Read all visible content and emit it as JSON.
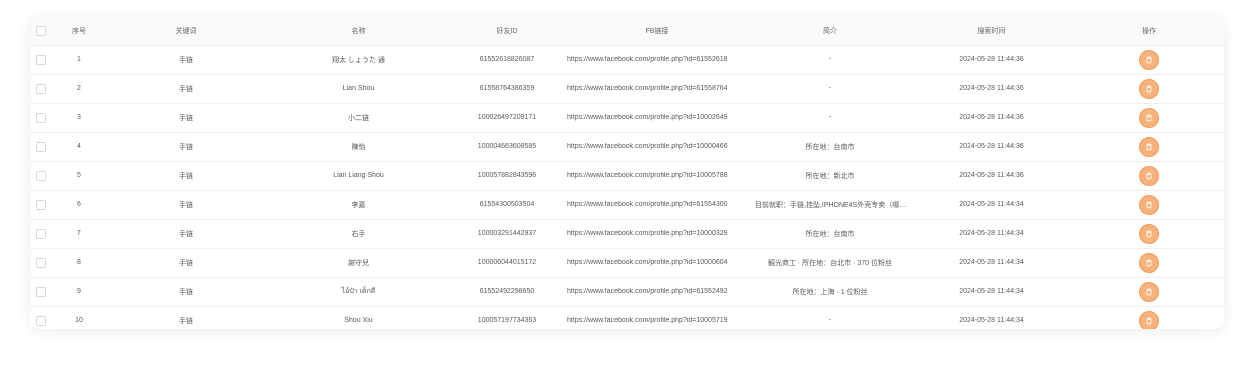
{
  "columns": {
    "index": "序号",
    "keyword": "关键词",
    "name": "名称",
    "friend_id": "好友ID",
    "fb_link": "FB链接",
    "intro": "简介",
    "search_time": "搜索时间",
    "action": "操作"
  },
  "rows": [
    {
      "index": "1",
      "keyword": "手链",
      "name": "翔太 しょうた 通",
      "friend_id": "61552618826087",
      "fb_link": "https://www.facebook.com/profile.php?id=61552618",
      "intro": "-",
      "search_time": "2024-05-28 11:44:36"
    },
    {
      "index": "2",
      "keyword": "手链",
      "name": "Lian Shou",
      "friend_id": "61558764386359",
      "fb_link": "https://www.facebook.com/profile.php?id=61558764",
      "intro": "-",
      "search_time": "2024-05-28 11:44:36"
    },
    {
      "index": "3",
      "keyword": "手链",
      "name": "小二链",
      "friend_id": "100026497209171",
      "fb_link": "https://www.facebook.com/profile.php?id=10002649",
      "intro": "-",
      "search_time": "2024-05-28 11:44:36"
    },
    {
      "index": "4",
      "keyword": "手链",
      "name": "陳怡",
      "friend_id": "100004663608585",
      "fb_link": "https://www.facebook.com/profile.php?id=10000466",
      "intro": "所在地：台南市",
      "search_time": "2024-05-28 11:44:36"
    },
    {
      "index": "5",
      "keyword": "手链",
      "name": "Lian Liang Shou",
      "friend_id": "100057882843596",
      "fb_link": "https://www.facebook.com/profile.php?id=10005788",
      "intro": "所在地：新北市",
      "search_time": "2024-05-28 11:44:36"
    },
    {
      "index": "6",
      "keyword": "手链",
      "name": "李嘉",
      "friend_id": "61554300503504",
      "fb_link": "https://www.facebook.com/profile.php?id=61554300",
      "intro": "目前就职：手链,挂坠,IPHONE4S外壳专卖（哪…",
      "search_time": "2024-05-28 11:44:34"
    },
    {
      "index": "7",
      "keyword": "手链",
      "name": "右手",
      "friend_id": "100003291442937",
      "fb_link": "https://www.facebook.com/profile.php?id=10000329",
      "intro": "所在地：台南市",
      "search_time": "2024-05-28 11:44:34"
    },
    {
      "index": "8",
      "keyword": "手链",
      "name": "謝守兒",
      "friend_id": "100006044015172",
      "fb_link": "https://www.facebook.com/profile.php?id=10000604",
      "intro": "観光商工 · 所在地：台北市 · 370 位粉丝",
      "search_time": "2024-05-28 11:44:34"
    },
    {
      "index": "9",
      "keyword": "手链",
      "name": "ไอ้ป๋า เด็กดี",
      "friend_id": "61552492298650",
      "fb_link": "https://www.facebook.com/profile.php?id=61552492",
      "intro": "所在地：上海 · 1 位粉丝",
      "search_time": "2024-05-28 11:44:34"
    },
    {
      "index": "10",
      "keyword": "手链",
      "name": "Shou Xiu",
      "friend_id": "100057197734363",
      "fb_link": "https://www.facebook.com/profile.php?id=10005719",
      "intro": "-",
      "search_time": "2024-05-28 11:44:34"
    }
  ],
  "action_icon": "delete-icon",
  "colors": {
    "action_button": "#f7b27d",
    "action_border": "#f29a58",
    "header_bg": "#fafafa"
  }
}
